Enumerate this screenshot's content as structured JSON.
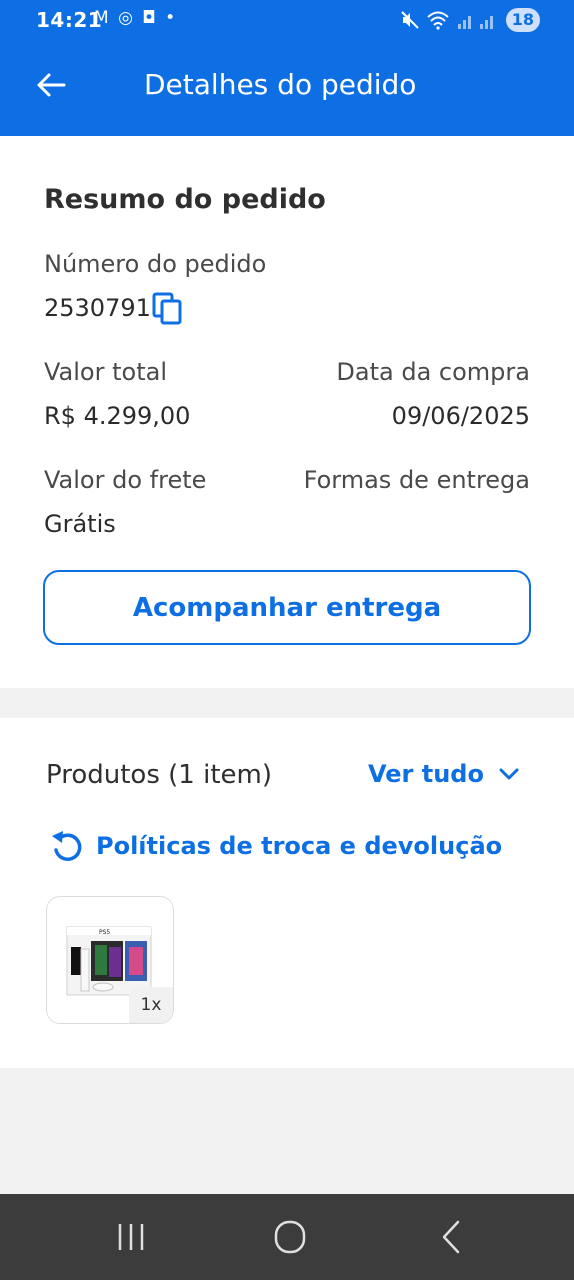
{
  "status_bar": {
    "time": "14:21",
    "notification_icons": "M ◎ ◘ •",
    "battery": "18"
  },
  "header": {
    "title": "Detalhes do pedido",
    "back_icon": "arrow-left-icon"
  },
  "summary": {
    "title": "Resumo do pedido",
    "order_number_label": "Número do pedido",
    "order_number": "2530791",
    "total_label": "Valor total",
    "total_value": "R$ 4.299,00",
    "date_label": "Data da compra",
    "date_value": "09/06/2025",
    "shipping_label": "Valor do frete",
    "shipping_value": "Grátis",
    "delivery_label": "Formas de entrega",
    "track_button": "Acompanhar entrega"
  },
  "products": {
    "title": "Produtos (1 item)",
    "see_all": "Ver tudo",
    "policy_link": "Políticas de troca e devolução",
    "items": [
      {
        "quantity": "1x"
      }
    ]
  },
  "colors": {
    "brand": "#0d6fe3",
    "background": "#f2f2f2",
    "navbar": "#3c3c3c"
  }
}
